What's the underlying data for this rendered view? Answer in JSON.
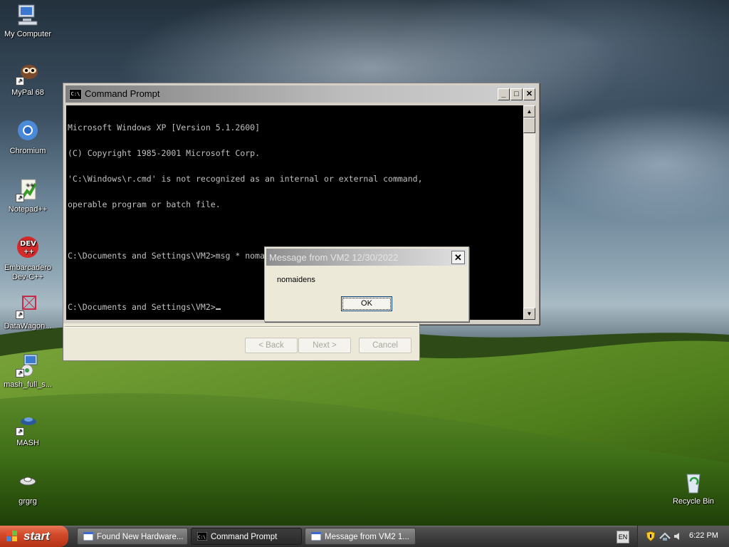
{
  "desktop": {
    "icons": [
      {
        "label": "My Computer"
      },
      {
        "label": "MyPal 68"
      },
      {
        "label": "Chromium"
      },
      {
        "label": "Notepad++"
      },
      {
        "label": "Embarcadero Dev-C++"
      },
      {
        "label": "DataWagon..."
      },
      {
        "label": "mash_full_s..."
      },
      {
        "label": "MASH"
      },
      {
        "label": "grgrg"
      },
      {
        "label": "Recycle Bin"
      }
    ]
  },
  "cmd_window": {
    "title": "Command Prompt",
    "icon_text": "C:\\",
    "buttons": {
      "minimize": "_",
      "maximize": "□",
      "close": "✕"
    },
    "lines": [
      "Microsoft Windows XP [Version 5.1.2600]",
      "(C) Copyright 1985-2001 Microsoft Corp.",
      "'C:\\Windows\\r.cmd' is not recognized as an internal or external command,",
      "operable program or batch file.",
      "",
      "C:\\Documents and Settings\\VM2>msg * nomaidens",
      "",
      "C:\\Documents and Settings\\VM2>"
    ]
  },
  "wizard": {
    "back_label": "< Back",
    "next_label": "Next >",
    "cancel_label": "Cancel"
  },
  "message_box": {
    "title": "Message from VM2 12/30/2022",
    "close_label": "✕",
    "message": "nomaidens",
    "ok_label": "OK"
  },
  "taskbar": {
    "start_label": "start",
    "tasks": [
      {
        "label": "Found New Hardware..."
      },
      {
        "label": "Command Prompt"
      },
      {
        "label": "Message from VM2 1..."
      }
    ],
    "language": "EN",
    "clock": "6:22 PM"
  }
}
